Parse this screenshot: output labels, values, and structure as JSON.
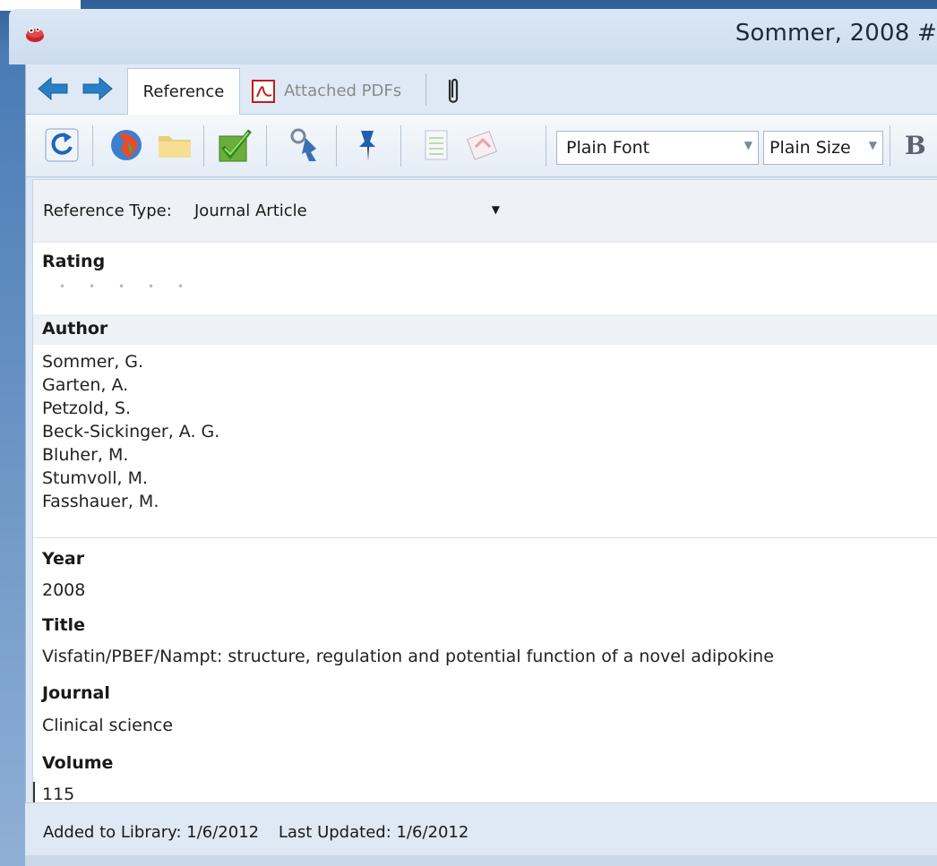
{
  "window": {
    "title": "Sommer, 2008 #"
  },
  "tabs": [
    {
      "label": "Reference",
      "active": true
    },
    {
      "label": "Attached PDFs",
      "active": false
    }
  ],
  "toolbar": {
    "font_value": "Plain Font",
    "size_value": "Plain Size",
    "bold_label": "B"
  },
  "reference_type": {
    "label": "Reference Type:",
    "value": "Journal Article"
  },
  "fields": {
    "rating": {
      "label": "Rating",
      "stars_total": 5,
      "stars_filled": 0
    },
    "author": {
      "label": "Author",
      "values": [
        "Sommer, G.",
        "Garten, A.",
        "Petzold, S.",
        "Beck-Sickinger, A. G.",
        "Bluher, M.",
        "Stumvoll, M.",
        "Fasshauer, M."
      ]
    },
    "year": {
      "label": "Year",
      "value": "2008"
    },
    "title": {
      "label": "Title",
      "value": "Visfatin/PBEF/Nampt: structure, regulation and potential function of a novel adipokine"
    },
    "journal": {
      "label": "Journal",
      "value": "Clinical science"
    },
    "volume": {
      "label": "Volume",
      "value": "115"
    }
  },
  "status": {
    "added": "Added to Library: 1/6/2012",
    "updated": "Last Updated: 1/6/2012"
  },
  "colors": {
    "frame": "#4a7bb5",
    "chrome": "#dfe9f5",
    "label_band": "#eef1f5"
  }
}
